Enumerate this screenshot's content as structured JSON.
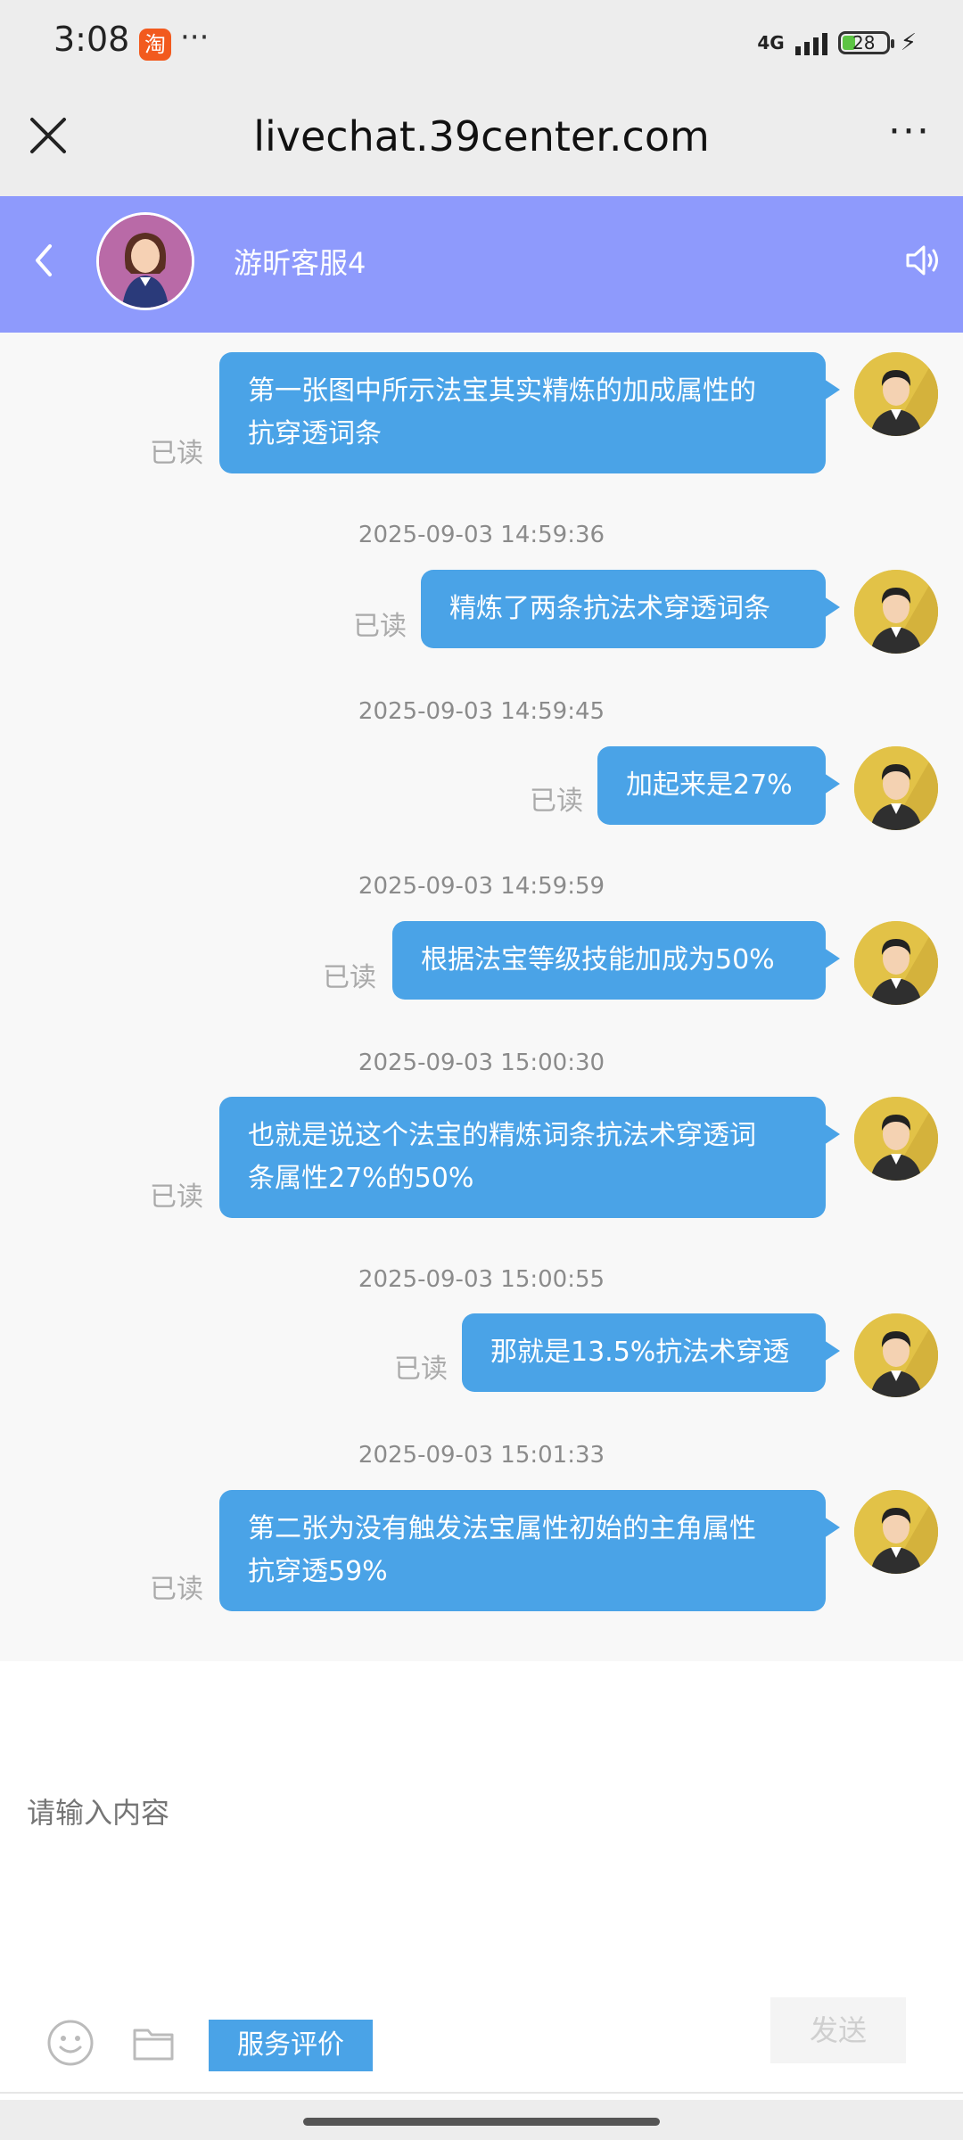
{
  "status_bar": {
    "time": "3:08",
    "app_badge": "淘",
    "more": "···",
    "network": "4G",
    "battery": "28",
    "charge": "⚡"
  },
  "browser": {
    "close_icon": "close-icon",
    "title": "livechat.39center.com",
    "more": "···"
  },
  "chat_header": {
    "agent_name": "游昕客服4",
    "colors": {
      "header_bg": "#8e9afc"
    }
  },
  "messages": [
    {
      "text_lines": [
        "第一张图中所示法宝其实精炼的加成属性的",
        "抗穿透词条"
      ],
      "read": "已读"
    },
    {
      "timestamp": "2025-09-03 14:59:36",
      "text_lines": [
        "精炼了两条抗法术穿透词条"
      ],
      "read": "已读"
    },
    {
      "timestamp": "2025-09-03 14:59:45",
      "text_lines": [
        "加起来是27%"
      ],
      "read": "已读"
    },
    {
      "timestamp": "2025-09-03 14:59:59",
      "text_lines": [
        "根据法宝等级技能加成为50%"
      ],
      "read": "已读"
    },
    {
      "timestamp": "2025-09-03 15:00:30",
      "text_lines": [
        "也就是说这个法宝的精炼词条抗法术穿透词",
        "条属性27%的50%"
      ],
      "read": "已读"
    },
    {
      "timestamp": "2025-09-03 15:00:55",
      "text_lines": [
        "那就是13.5%抗法术穿透"
      ],
      "read": "已读"
    },
    {
      "timestamp": "2025-09-03 15:01:33",
      "text_lines": [
        "第二张为没有触发法宝属性初始的主角属性",
        "抗穿透59%"
      ],
      "read": "已读"
    }
  ],
  "input": {
    "placeholder": "请输入内容",
    "rate_button": "服务评价",
    "send_button": "发送"
  },
  "colors": {
    "bubble": "#4aa3e7",
    "accent": "#8e9afc"
  }
}
